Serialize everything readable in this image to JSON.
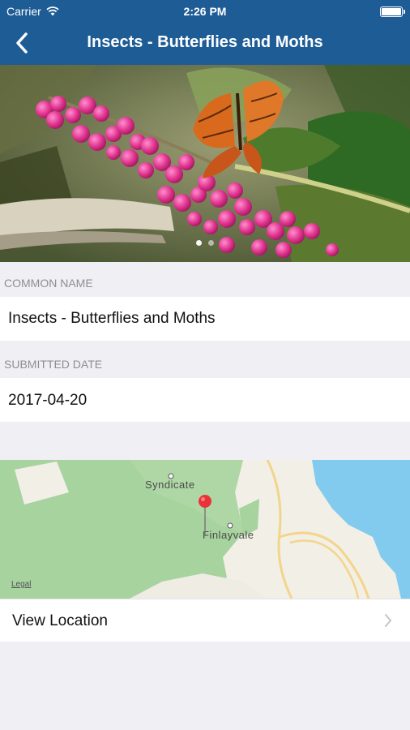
{
  "status_bar": {
    "carrier": "Carrier",
    "time": "2:26 PM"
  },
  "nav": {
    "title": "Insects - Butterflies and Moths"
  },
  "details": {
    "common_name_header": "COMMON NAME",
    "common_name": "Insects - Butterflies and Moths",
    "submitted_date_header": "SUBMITTED DATE",
    "submitted_date": "2017-04-20"
  },
  "map": {
    "place_labels": [
      "Syndicate",
      "Finlayvale"
    ],
    "legal": "Legal"
  },
  "location_cell": {
    "label": "View Location"
  },
  "colors": {
    "nav_bar": "#1e5c96",
    "background": "#efeff4",
    "map_forest": "#a6d39e",
    "map_land": "#f2efe7",
    "map_water": "#82cbee",
    "pin": "#e8333a"
  },
  "icons": [
    "wifi-icon",
    "battery-icon",
    "back-chevron-icon",
    "map-pin-icon",
    "chevron-right-icon"
  ]
}
